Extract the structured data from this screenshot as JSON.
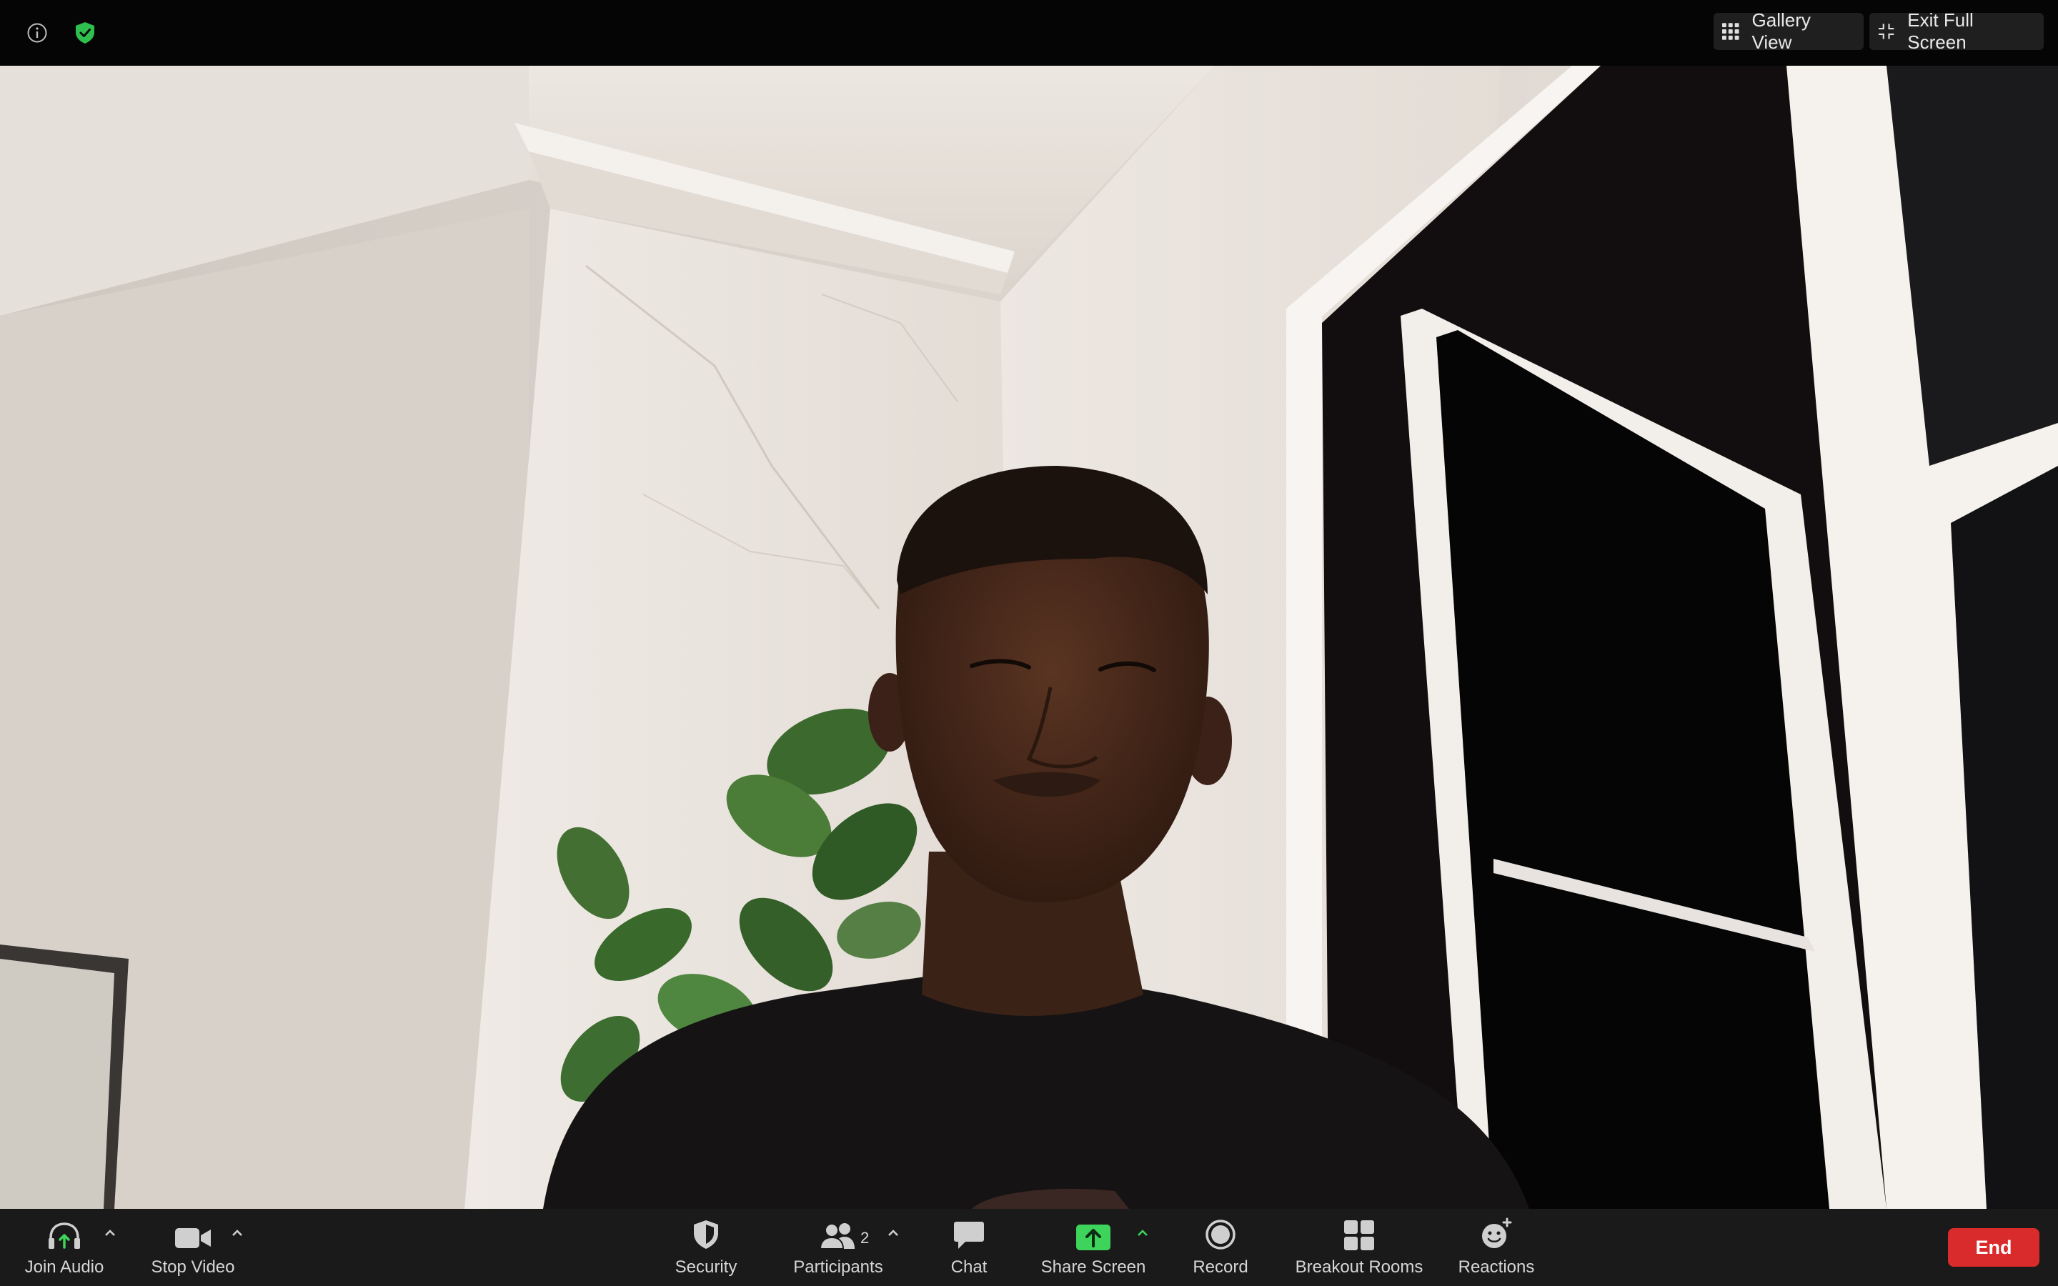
{
  "top_bar": {
    "info_icon": "info-icon",
    "security_badge_icon": "shield-check-icon",
    "gallery_view_label": "Gallery View",
    "exit_full_screen_label": "Exit Full Screen"
  },
  "toolbar": {
    "join_audio_label": "Join Audio",
    "stop_video_label": "Stop Video",
    "security_label": "Security",
    "participants_label": "Participants",
    "participants_count": "2",
    "chat_label": "Chat",
    "share_screen_label": "Share Screen",
    "record_label": "Record",
    "breakout_rooms_label": "Breakout Rooms",
    "reactions_label": "Reactions",
    "end_label": "End"
  },
  "colors": {
    "share_screen_accent": "#3ed35a",
    "end_button": "#d92b2b",
    "shield_badge": "#2fbf4f"
  }
}
